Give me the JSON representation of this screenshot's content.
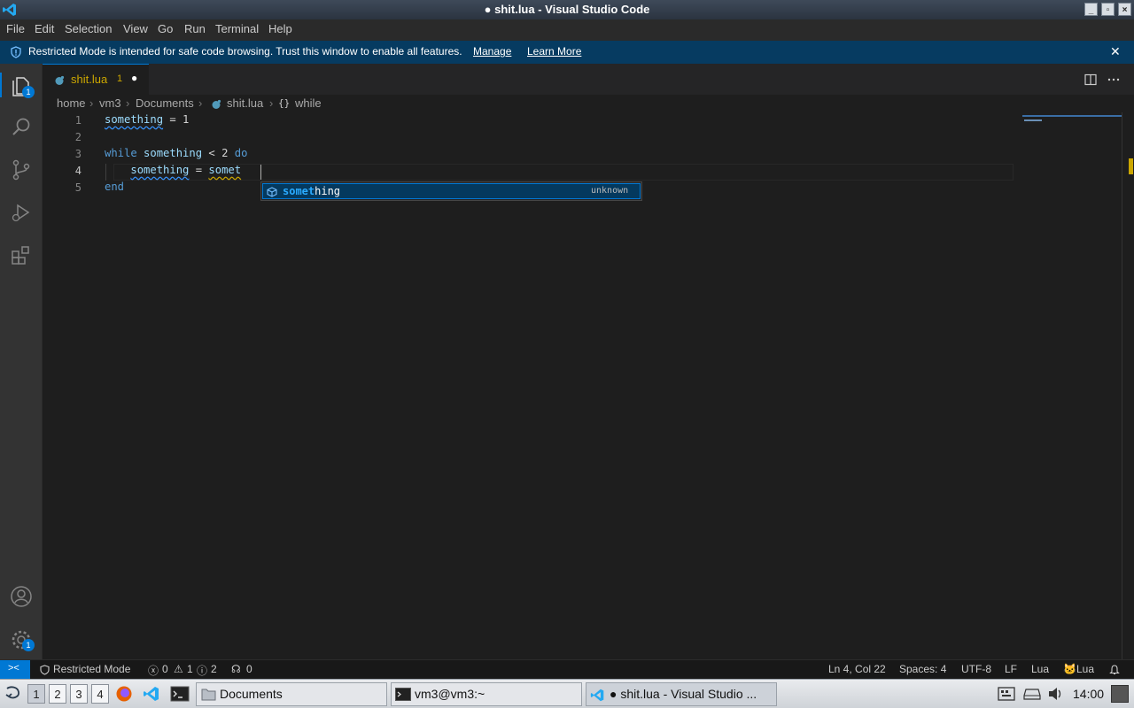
{
  "window": {
    "title": "● shit.lua - Visual Studio Code",
    "minimize": "_",
    "maximize": "▫",
    "close": "×"
  },
  "menu": [
    "File",
    "Edit",
    "Selection",
    "View",
    "Go",
    "Run",
    "Terminal",
    "Help"
  ],
  "banner": {
    "message": "Restricted Mode is intended for safe code browsing. Trust this window to enable all features.",
    "manage": "Manage",
    "learn_more": "Learn More",
    "close": "✕"
  },
  "activity": {
    "explorer_badge": "1",
    "settings_badge": "1"
  },
  "tab": {
    "filename": "shit.lua",
    "problems": "1",
    "dirty_marker": "●"
  },
  "breadcrumbs": [
    "home",
    "vm3",
    "Documents",
    "shit.lua",
    "while"
  ],
  "editor": {
    "line_numbers": [
      "1",
      "2",
      "3",
      "4",
      "5"
    ],
    "lines": {
      "l1_var": "something",
      "l1_rest": " = 1",
      "l3_kw": "while",
      "l3_var": "something",
      "l3_rest": " < 2 ",
      "l3_do": "do",
      "l4_var": "something",
      "l4_eq": " = ",
      "l4_typed": "somet",
      "l5_kw": "end"
    }
  },
  "suggestion": {
    "match": "somet",
    "rest": "hing",
    "type": "unknown",
    "icon": "symbol-variable-icon"
  },
  "status": {
    "remote": "><",
    "restricted": "Restricted Mode",
    "errors": "0",
    "warnings": "1",
    "infos": "2",
    "ports": "0",
    "position": "Ln 4, Col 22",
    "spaces": "Spaces: 4",
    "encoding": "UTF-8",
    "eol": "LF",
    "language": "Lua",
    "lua_ext": "Lua"
  },
  "taskbar": {
    "workspaces": [
      "1",
      "2",
      "3",
      "4"
    ],
    "tasks": [
      "Documents",
      "vm3@vm3:~",
      "● shit.lua - Visual Studio ..."
    ],
    "clock": "14:00"
  },
  "colors": {
    "accent": "#0078d4",
    "banner": "#063b61",
    "editor_bg": "#1e1e1e"
  }
}
